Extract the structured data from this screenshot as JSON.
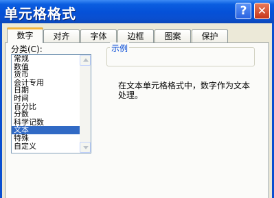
{
  "window": {
    "title": "单元格格式",
    "help_glyph": "?",
    "close_glyph": "✕"
  },
  "tabs": [
    {
      "label": "数字",
      "active": true
    },
    {
      "label": "对齐",
      "active": false
    },
    {
      "label": "字体",
      "active": false
    },
    {
      "label": "边框",
      "active": false
    },
    {
      "label": "图案",
      "active": false
    },
    {
      "label": "保护",
      "active": false
    }
  ],
  "category": {
    "label": "分类(C):",
    "items": [
      "常规",
      "数值",
      "货币",
      "会计专用",
      "日期",
      "时间",
      "百分比",
      "分数",
      "科学记数",
      "文本",
      "特殊",
      "自定义"
    ],
    "selected": "文本"
  },
  "sample": {
    "label": "示例",
    "value": ""
  },
  "description": "在文本单元格格式中，数字作为文本处理。",
  "colors": {
    "title_bar": "#0551d8",
    "selection": "#316ac5",
    "active_tab_accent": "#f4b43a"
  }
}
